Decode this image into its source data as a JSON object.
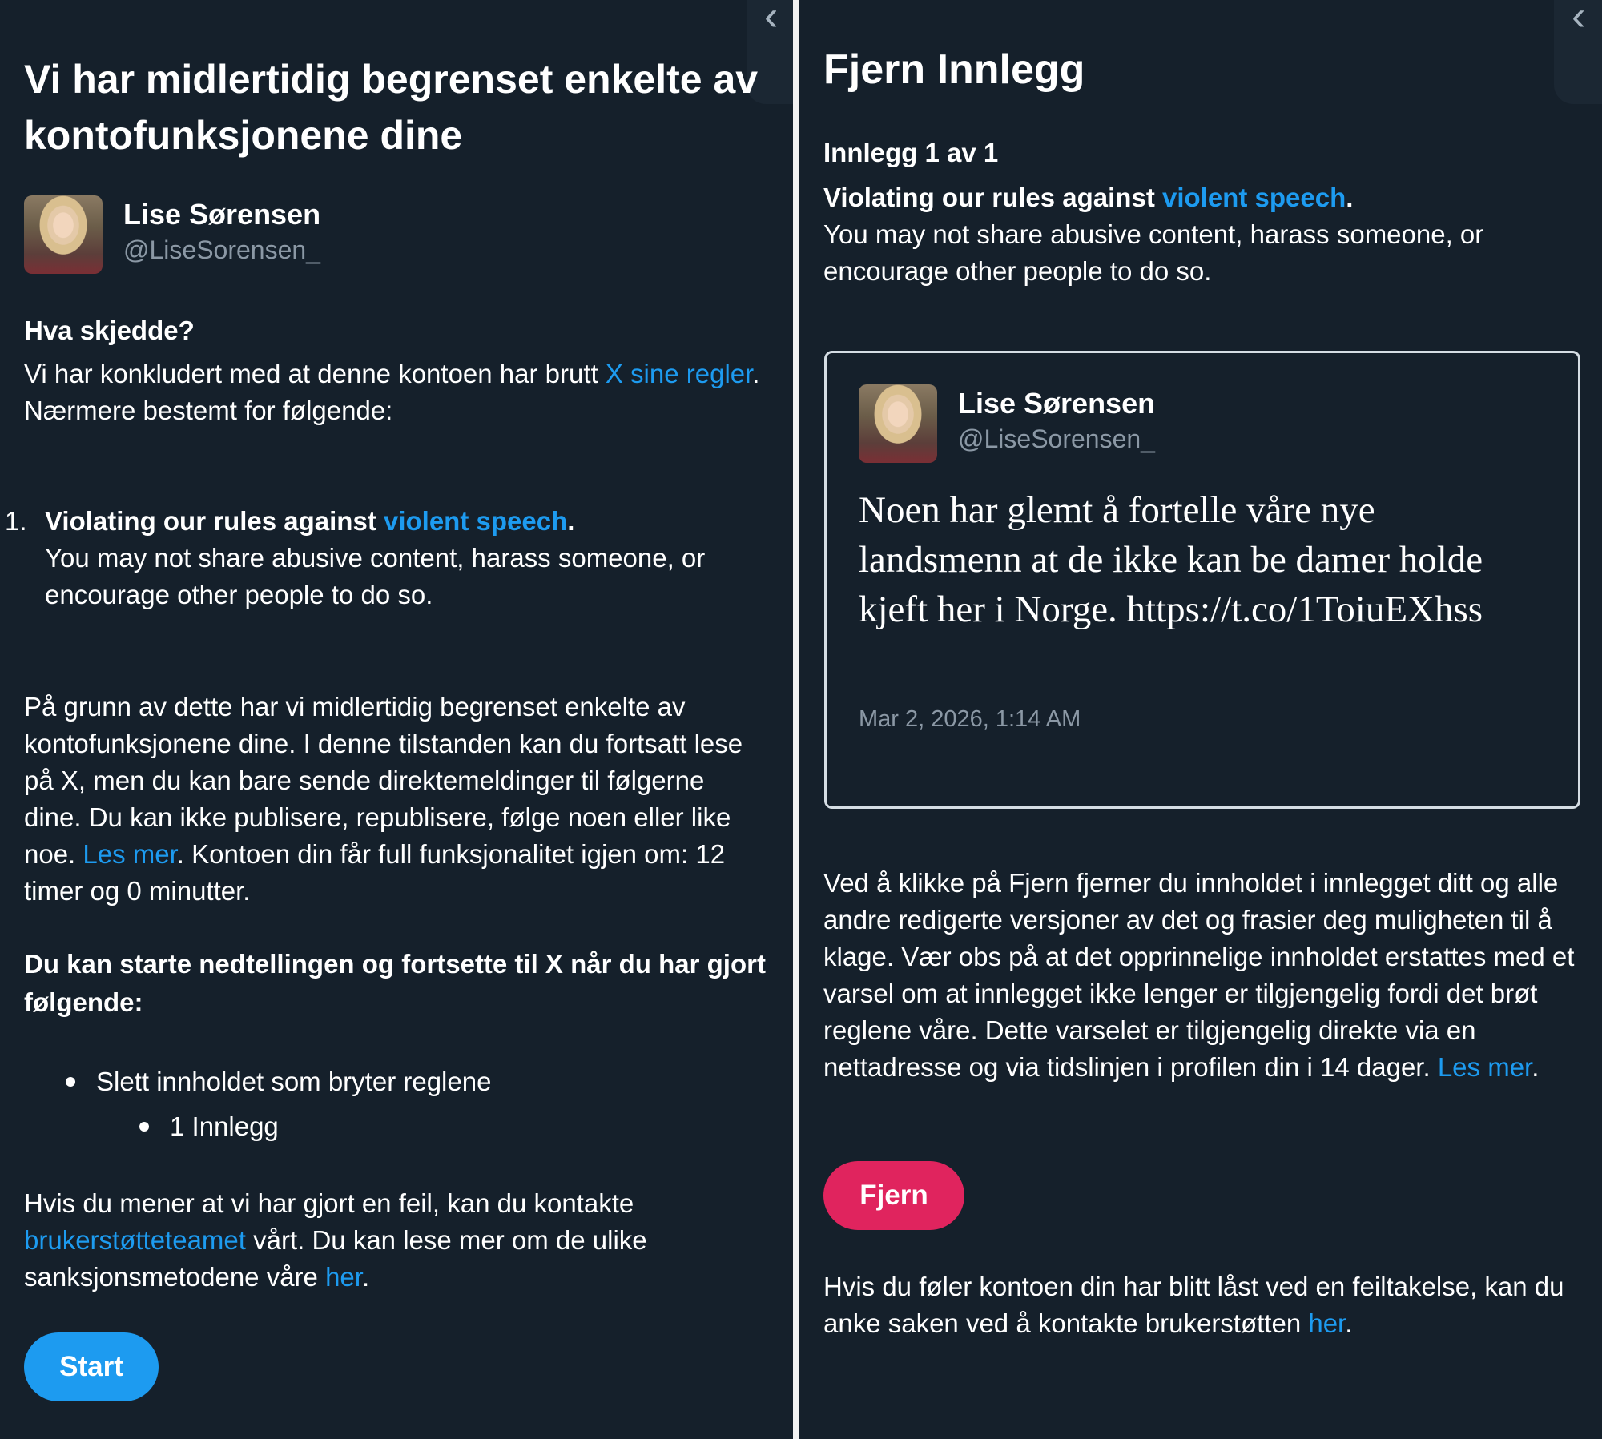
{
  "left": {
    "title": "Vi har midlertidig begrenset enkelte av kontofunksjonene dine",
    "user": {
      "name": "Lise Sørensen",
      "handle": "@LiseSorensen_"
    },
    "what_happened_heading": "Hva skjedde?",
    "intro_before": "Vi har konkludert med at denne kontoen har brutt ",
    "intro_link": "X sine regler",
    "intro_after": ". Nærmere bestemt for følgende:",
    "violation_number": "1.",
    "violation_title_before": "Violating our rules against ",
    "violation_title_link": "violent speech",
    "violation_title_after": ".",
    "violation_desc": "You may not share abusive content, harass someone, or encourage other people to do so.",
    "restriction_before": "På grunn av dette har vi midlertidig begrenset enkelte av kontofunksjonene dine. I denne tilstanden kan du fortsatt lese på X, men du kan bare sende direktemeldinger til følgerne dine. Du kan ikke publisere, republisere, følge noen eller like noe. ",
    "restriction_link": "Les mer",
    "restriction_after": ". Kontoen din får full funksjonalitet igjen om: 12 timer og 0 minutter.",
    "countdown_heading": "Du kan starte nedtellingen og fortsette til X når du har gjort følgende:",
    "bullet_1": "Slett innholdet som bryter reglene",
    "bullet_2": "1 Innlegg",
    "contact_before": "Hvis du mener at vi har gjort en feil, kan du kontakte ",
    "contact_link": "brukerstøtteteamet",
    "contact_middle": " vårt. Du kan lese mer om de ulike sanksjonsmetodene våre ",
    "contact_link2": "her",
    "contact_after": ".",
    "start_button": "Start"
  },
  "right": {
    "title": "Fjern Innlegg",
    "post_counter": "Innlegg 1 av 1",
    "violation_title_before": "Violating our rules against ",
    "violation_title_link": "violent speech",
    "violation_title_after": ".",
    "violation_desc": "You may not share abusive content, harass someone, or encourage other people to do so.",
    "post": {
      "name": "Lise Sørensen",
      "handle": "@LiseSorensen_",
      "text": "Noen har glemt å fortelle våre nye landsmenn at de ikke kan be damer holde kjeft her i Norge. https://t.co/1ToiuEXhss",
      "time": "Mar 2, 2026, 1:14 AM"
    },
    "remove_info_before": "Ved å klikke på Fjern fjerner du innholdet i innlegget ditt og alle andre redigerte versjoner av det og frasier deg muligheten til å klage. Vær obs på at det opprinnelige innholdet erstattes med et varsel om at innlegget ikke lenger er tilgjengelig fordi det brøt reglene våre. Dette varselet er tilgjengelig direkte via en nettadresse og via tidslinjen i profilen din i 14 dager. ",
    "remove_info_link": "Les mer",
    "remove_info_after": ".",
    "remove_button": "Fjern",
    "appeal_before": "Hvis du føler kontoen din har blitt låst ved en feiltakelse, kan du anke saken ved å kontakte brukerstøtten ",
    "appeal_link": "her",
    "appeal_after": "."
  },
  "colors": {
    "background": "#15202b",
    "link": "#1d9bf0",
    "start_button": "#1d9bf0",
    "remove_button": "#e0245e",
    "secondary_text": "#8b98a5"
  },
  "icons": {
    "back_chevron": "chevron-left-icon"
  }
}
